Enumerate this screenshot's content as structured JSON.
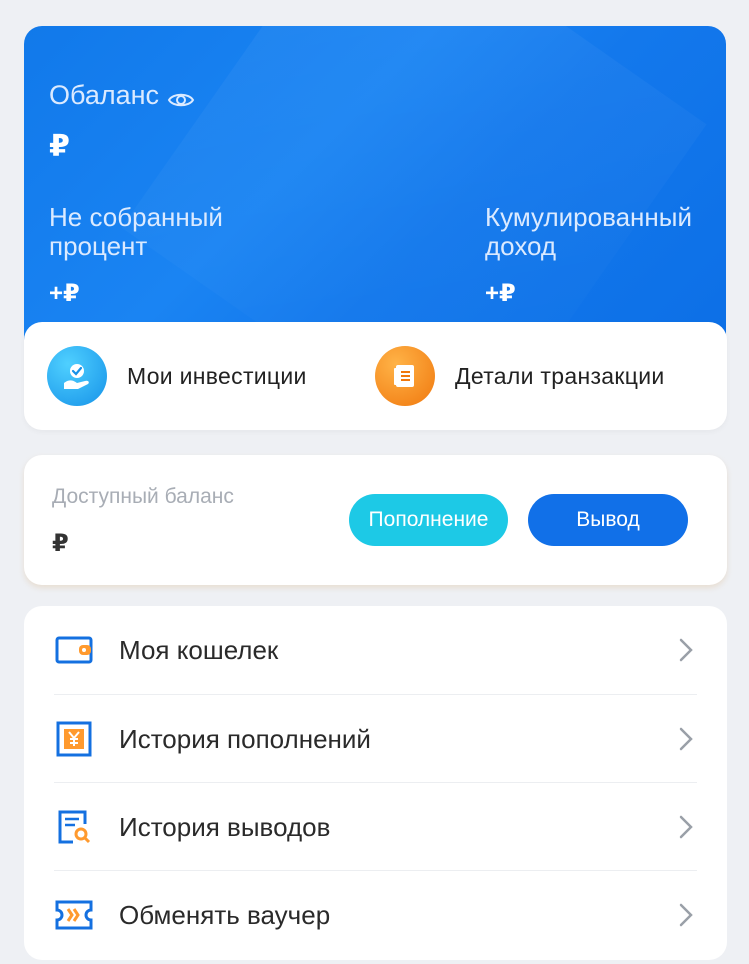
{
  "balance": {
    "title": "Обаланс",
    "amount": "₽",
    "uncollected_label": "Не собранный процент",
    "uncollected_value": "+₽",
    "cumulative_label": "Кумулированный доход",
    "cumulative_value": "+₽"
  },
  "quick_actions": [
    {
      "label": "Мои инвестиции",
      "icon": "investment-hand-icon",
      "color": "#1692e8"
    },
    {
      "label": "Детали транзакции",
      "icon": "document-list-icon",
      "color": "#f0780e"
    }
  ],
  "available": {
    "label": "Доступный баланс",
    "amount": "₽",
    "topup_label": "Пополнение",
    "withdraw_label": "Вывод"
  },
  "menu": [
    {
      "label": "Моя кошелек",
      "icon": "wallet-icon"
    },
    {
      "label": "История пополнений",
      "icon": "yen-deposit-icon"
    },
    {
      "label": "История выводов",
      "icon": "withdraw-search-icon"
    },
    {
      "label": "Обменять ваучер",
      "icon": "voucher-ticket-icon"
    }
  ],
  "colors": {
    "primary_blue": "#1170e8",
    "accent_cyan": "#1dc9e6",
    "accent_orange": "#f0780e",
    "background": "#eef0f4"
  }
}
